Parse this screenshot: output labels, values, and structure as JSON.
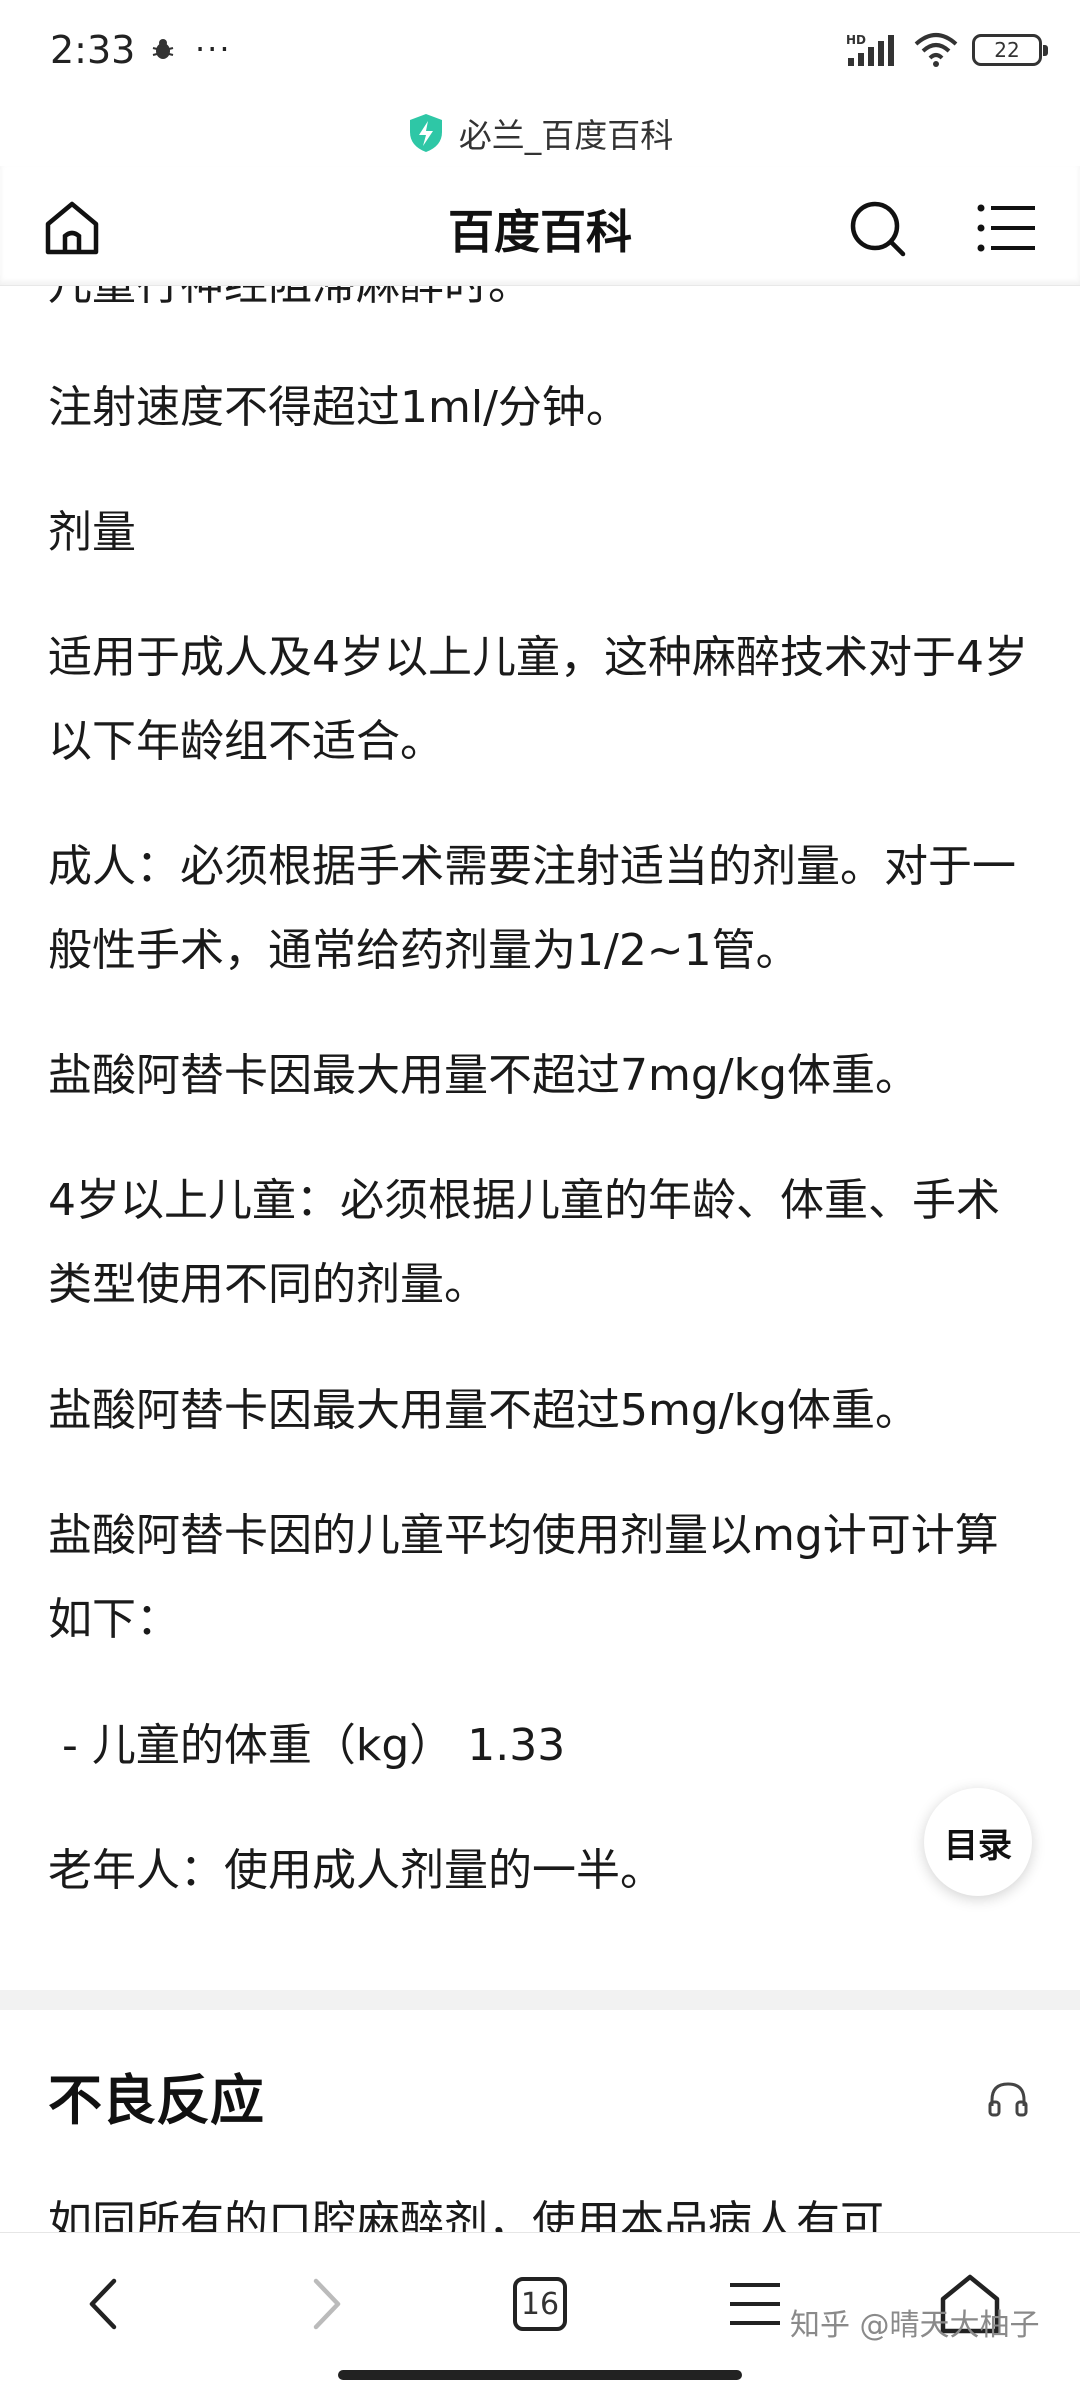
{
  "status_bar": {
    "time": "2:33",
    "dots": "···",
    "network": "HD",
    "battery": "22"
  },
  "url_bar": {
    "page_title": "必兰_百度百科",
    "shield_color": "#2ec7a6"
  },
  "header": {
    "title": "百度百科"
  },
  "content": {
    "clipped_line": "儿童行神经阻滞麻醉时。",
    "paragraphs": [
      "注射速度不得超过1ml/分钟。",
      "剂量",
      "适用于成人及4岁以上儿童，这种麻醉技术对于4岁以下年龄组不适合。",
      "成人：必须根据手术需要注射适当的剂量。对于一般性手术，通常给药剂量为1/2~1管。",
      "盐酸阿替卡因最大用量不超过7mg/kg体重。",
      "4岁以上儿童：必须根据儿童的年龄、体重、手术类型使用不同的剂量。",
      "盐酸阿替卡因最大用量不超过5mg/kg体重。",
      "盐酸阿替卡因的儿童平均使用剂量以mg计可计算如下：",
      " - 儿童的体重（kg） 1.33",
      "老年人：使用成人剂量的一半。"
    ],
    "toc_label": "目录",
    "section_title": "不良反应",
    "section_first_line": "如同所有的口腔麻醉剂，使用本品病人有可"
  },
  "bottom_bar": {
    "tabs_count": "16"
  },
  "watermark": "知乎 @晴天大柚子"
}
